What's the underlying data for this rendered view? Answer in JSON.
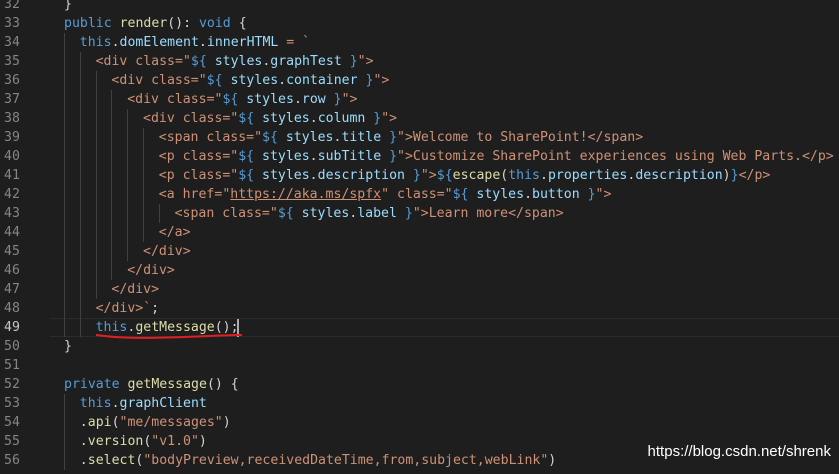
{
  "colors": {
    "background": "#1e1e1e",
    "line_number": "#858585",
    "keyword": "#569cd6",
    "function": "#dcdcaa",
    "property": "#9cdcfe",
    "string": "#ce9178",
    "annotation_underline": "#e02020"
  },
  "editor": {
    "active_line": 49,
    "lines": [
      {
        "n": "32",
        "indent": 0,
        "tokens": [
          {
            "t": "}",
            "c": "punc"
          }
        ]
      },
      {
        "n": "33",
        "indent": 0,
        "tokens": [
          {
            "t": "public ",
            "c": "kw"
          },
          {
            "t": "render",
            "c": "fn"
          },
          {
            "t": "(): ",
            "c": "punc"
          },
          {
            "t": "void",
            "c": "kw"
          },
          {
            "t": " {",
            "c": "punc"
          }
        ]
      },
      {
        "n": "34",
        "indent": 1,
        "tokens": [
          {
            "t": "this",
            "c": "kw"
          },
          {
            "t": ".",
            "c": "punc"
          },
          {
            "t": "domElement",
            "c": "prop"
          },
          {
            "t": ".",
            "c": "punc"
          },
          {
            "t": "innerHTML",
            "c": "prop"
          },
          {
            "t": " = `",
            "c": "str"
          }
        ]
      },
      {
        "n": "35",
        "indent": 2,
        "tokens": [
          {
            "t": "<div class=\"",
            "c": "str"
          },
          {
            "t": "${ ",
            "c": "kw"
          },
          {
            "t": "styles",
            "c": "prop"
          },
          {
            "t": ".",
            "c": "punc"
          },
          {
            "t": "graphTest",
            "c": "prop"
          },
          {
            "t": " }",
            "c": "kw"
          },
          {
            "t": "\">",
            "c": "str"
          }
        ]
      },
      {
        "n": "36",
        "indent": 3,
        "tokens": [
          {
            "t": "<div class=\"",
            "c": "str"
          },
          {
            "t": "${ ",
            "c": "kw"
          },
          {
            "t": "styles",
            "c": "prop"
          },
          {
            "t": ".",
            "c": "punc"
          },
          {
            "t": "container",
            "c": "prop"
          },
          {
            "t": " }",
            "c": "kw"
          },
          {
            "t": "\">",
            "c": "str"
          }
        ]
      },
      {
        "n": "37",
        "indent": 4,
        "tokens": [
          {
            "t": "<div class=\"",
            "c": "str"
          },
          {
            "t": "${ ",
            "c": "kw"
          },
          {
            "t": "styles",
            "c": "prop"
          },
          {
            "t": ".",
            "c": "punc"
          },
          {
            "t": "row",
            "c": "prop"
          },
          {
            "t": " }",
            "c": "kw"
          },
          {
            "t": "\">",
            "c": "str"
          }
        ]
      },
      {
        "n": "38",
        "indent": 5,
        "tokens": [
          {
            "t": "<div class=\"",
            "c": "str"
          },
          {
            "t": "${ ",
            "c": "kw"
          },
          {
            "t": "styles",
            "c": "prop"
          },
          {
            "t": ".",
            "c": "punc"
          },
          {
            "t": "column",
            "c": "prop"
          },
          {
            "t": " }",
            "c": "kw"
          },
          {
            "t": "\">",
            "c": "str"
          }
        ]
      },
      {
        "n": "39",
        "indent": 6,
        "tokens": [
          {
            "t": "<span class=\"",
            "c": "str"
          },
          {
            "t": "${ ",
            "c": "kw"
          },
          {
            "t": "styles",
            "c": "prop"
          },
          {
            "t": ".",
            "c": "punc"
          },
          {
            "t": "title",
            "c": "prop"
          },
          {
            "t": " }",
            "c": "kw"
          },
          {
            "t": "\">Welcome to SharePoint!</span>",
            "c": "str"
          }
        ]
      },
      {
        "n": "40",
        "indent": 6,
        "tokens": [
          {
            "t": "<p class=\"",
            "c": "str"
          },
          {
            "t": "${ ",
            "c": "kw"
          },
          {
            "t": "styles",
            "c": "prop"
          },
          {
            "t": ".",
            "c": "punc"
          },
          {
            "t": "subTitle",
            "c": "prop"
          },
          {
            "t": " }",
            "c": "kw"
          },
          {
            "t": "\">Customize SharePoint experiences using Web Parts.</p>",
            "c": "str"
          }
        ]
      },
      {
        "n": "41",
        "indent": 6,
        "tokens": [
          {
            "t": "<p class=\"",
            "c": "str"
          },
          {
            "t": "${ ",
            "c": "kw"
          },
          {
            "t": "styles",
            "c": "prop"
          },
          {
            "t": ".",
            "c": "punc"
          },
          {
            "t": "description",
            "c": "prop"
          },
          {
            "t": " }",
            "c": "kw"
          },
          {
            "t": "\">",
            "c": "str"
          },
          {
            "t": "${",
            "c": "kw"
          },
          {
            "t": "escape",
            "c": "fn"
          },
          {
            "t": "(",
            "c": "punc"
          },
          {
            "t": "this",
            "c": "kw"
          },
          {
            "t": ".",
            "c": "punc"
          },
          {
            "t": "properties",
            "c": "prop"
          },
          {
            "t": ".",
            "c": "punc"
          },
          {
            "t": "description",
            "c": "prop"
          },
          {
            "t": ")",
            "c": "punc"
          },
          {
            "t": "}",
            "c": "kw"
          },
          {
            "t": "</p>",
            "c": "str"
          }
        ]
      },
      {
        "n": "42",
        "indent": 6,
        "tokens": [
          {
            "t": "<a href=\"",
            "c": "str"
          },
          {
            "t": "https://aka.ms/spfx",
            "c": "url"
          },
          {
            "t": "\" class=\"",
            "c": "str"
          },
          {
            "t": "${ ",
            "c": "kw"
          },
          {
            "t": "styles",
            "c": "prop"
          },
          {
            "t": ".",
            "c": "punc"
          },
          {
            "t": "button",
            "c": "prop"
          },
          {
            "t": " }",
            "c": "kw"
          },
          {
            "t": "\">",
            "c": "str"
          }
        ]
      },
      {
        "n": "43",
        "indent": 7,
        "tokens": [
          {
            "t": "<span class=\"",
            "c": "str"
          },
          {
            "t": "${ ",
            "c": "kw"
          },
          {
            "t": "styles",
            "c": "prop"
          },
          {
            "t": ".",
            "c": "punc"
          },
          {
            "t": "label",
            "c": "prop"
          },
          {
            "t": " }",
            "c": "kw"
          },
          {
            "t": "\">Learn more</span>",
            "c": "str"
          }
        ]
      },
      {
        "n": "44",
        "indent": 6,
        "tokens": [
          {
            "t": "</a>",
            "c": "str"
          }
        ]
      },
      {
        "n": "45",
        "indent": 5,
        "tokens": [
          {
            "t": "</div>",
            "c": "str"
          }
        ]
      },
      {
        "n": "46",
        "indent": 4,
        "tokens": [
          {
            "t": "</div>",
            "c": "str"
          }
        ]
      },
      {
        "n": "47",
        "indent": 3,
        "tokens": [
          {
            "t": "</div>",
            "c": "str"
          }
        ]
      },
      {
        "n": "48",
        "indent": 2,
        "tokens": [
          {
            "t": "</div>`",
            "c": "str"
          },
          {
            "t": ";",
            "c": "punc"
          }
        ]
      },
      {
        "n": "49",
        "indent": 2,
        "tokens": [
          {
            "t": "this",
            "c": "kw"
          },
          {
            "t": ".",
            "c": "punc"
          },
          {
            "t": "getMessage",
            "c": "fn"
          },
          {
            "t": "();",
            "c": "punc"
          }
        ]
      },
      {
        "n": "50",
        "indent": 0,
        "tokens": [
          {
            "t": "}",
            "c": "punc"
          }
        ]
      },
      {
        "n": "51",
        "indent": 0,
        "tokens": []
      },
      {
        "n": "52",
        "indent": 0,
        "tokens": [
          {
            "t": "private ",
            "c": "kw"
          },
          {
            "t": "getMessage",
            "c": "fn"
          },
          {
            "t": "() {",
            "c": "punc"
          }
        ]
      },
      {
        "n": "53",
        "indent": 1,
        "tokens": [
          {
            "t": "this",
            "c": "kw"
          },
          {
            "t": ".",
            "c": "punc"
          },
          {
            "t": "graphClient",
            "c": "prop"
          }
        ]
      },
      {
        "n": "54",
        "indent": 1,
        "tokens": [
          {
            "t": ".",
            "c": "punc"
          },
          {
            "t": "api",
            "c": "fn"
          },
          {
            "t": "(",
            "c": "punc"
          },
          {
            "t": "\"me/messages\"",
            "c": "str"
          },
          {
            "t": ")",
            "c": "punc"
          }
        ]
      },
      {
        "n": "55",
        "indent": 1,
        "tokens": [
          {
            "t": ".",
            "c": "punc"
          },
          {
            "t": "version",
            "c": "fn"
          },
          {
            "t": "(",
            "c": "punc"
          },
          {
            "t": "\"v1.0\"",
            "c": "str"
          },
          {
            "t": ")",
            "c": "punc"
          }
        ]
      },
      {
        "n": "56",
        "indent": 1,
        "tokens": [
          {
            "t": ".",
            "c": "punc"
          },
          {
            "t": "select",
            "c": "fn"
          },
          {
            "t": "(",
            "c": "punc"
          },
          {
            "t": "\"bodyPreview,receivedDateTime,from,subject,webLink\"",
            "c": "str"
          },
          {
            "t": ")",
            "c": "punc"
          }
        ]
      }
    ]
  },
  "watermark": {
    "text": "https://blog.csdn.net/shrenk"
  }
}
